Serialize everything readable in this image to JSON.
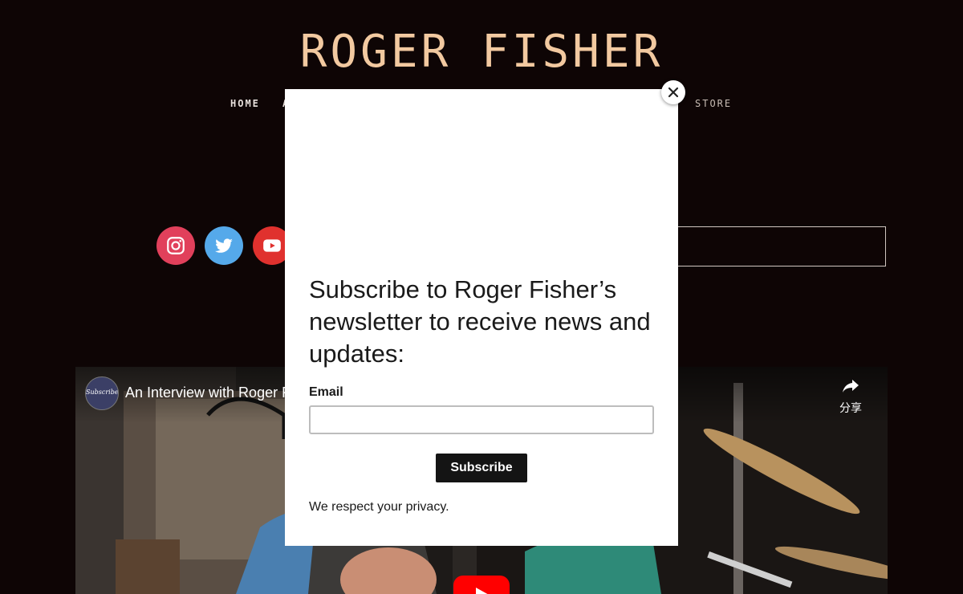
{
  "site": {
    "title": "ROGER FISHER"
  },
  "nav": {
    "items": [
      {
        "label": "HOME"
      },
      {
        "label": "A"
      },
      {
        "label": "STORE"
      }
    ]
  },
  "social": {
    "icons": [
      "instagram-icon",
      "twitter-icon",
      "youtube-icon"
    ],
    "colors": {
      "instagram": "#e1405b",
      "twitter": "#55a9ea",
      "youtube": "#e0312e"
    }
  },
  "video": {
    "title": "An Interview with Roger F",
    "channel_avatar_text": "Subscribe",
    "share_label": "分享",
    "play_color": "#ff0000"
  },
  "modal": {
    "heading": "Subscribe to Roger Fisher’s newsletter to receive news and updates:",
    "email_label": "Email",
    "email_value": "",
    "subscribe_label": "Subscribe",
    "privacy_text": "We respect your privacy."
  },
  "colors": {
    "background": "#0e0505",
    "title": "#f2c9a0",
    "button": "#141414"
  }
}
